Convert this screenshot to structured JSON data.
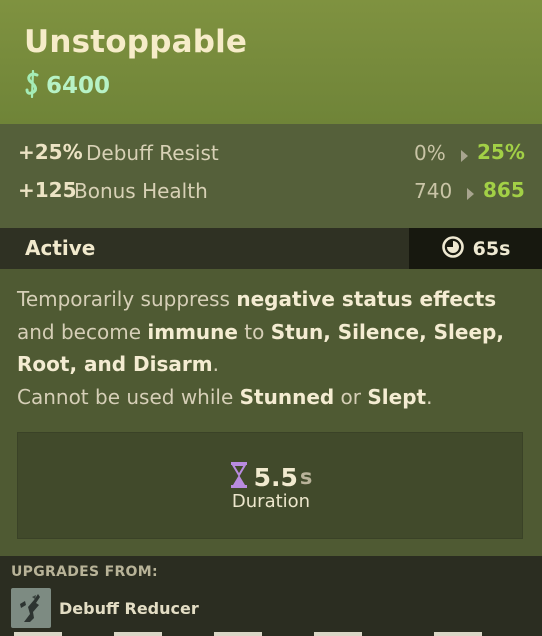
{
  "item": {
    "name": "Unstoppable",
    "cost": "6400",
    "cost_icon": "souls-icon",
    "accent": "#a2d046"
  },
  "stats": [
    {
      "bonus": "+25%",
      "label": "Debuff Resist",
      "from": "0%",
      "to": "25%"
    },
    {
      "bonus": "+125",
      "label": "Bonus Health",
      "from": "740",
      "to": "865"
    }
  ],
  "active": {
    "label": "Active",
    "cooldown": "65s",
    "cooldown_icon": "cooldown-clock-icon"
  },
  "description": {
    "l1_a": "Temporarily suppress ",
    "l1_b": "negative status effects",
    "l2_a": "and become ",
    "l2_b": "immune",
    "l2_c": " to ",
    "l2_d": "Stun, Silence, Sleep,",
    "l3_a": "Root, and Disarm",
    "l3_b": ".",
    "l4_a": "Cannot be used while ",
    "l4_b": "Stunned",
    "l4_c": " or ",
    "l4_d": "Slept",
    "l4_e": "."
  },
  "duration": {
    "value": "5.5",
    "unit": "s",
    "label": "Duration",
    "icon": "hourglass-icon"
  },
  "upgrades": {
    "title": "UPGRADES FROM:",
    "items": [
      {
        "name": "Debuff Reducer",
        "icon": "debuff-reducer-icon"
      }
    ]
  }
}
